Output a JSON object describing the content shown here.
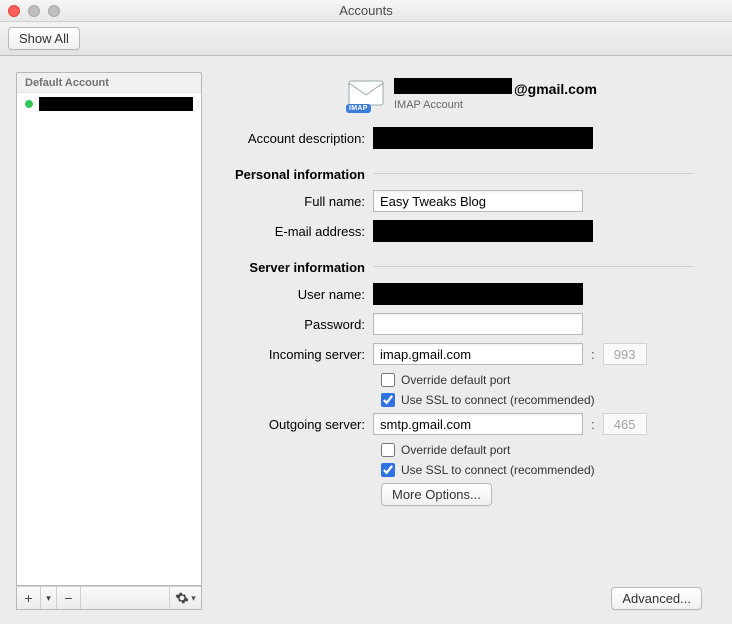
{
  "window": {
    "title": "Accounts"
  },
  "toolbar": {
    "show_all": "Show All"
  },
  "sidebar": {
    "group_label": "Default Account",
    "accounts": [
      {
        "name_redacted": true,
        "online": true
      }
    ],
    "icons": {
      "add": "+",
      "remove": "−",
      "gear": "gear"
    }
  },
  "main": {
    "header": {
      "email_suffix": "@gmail.com",
      "type_label": "IMAP Account",
      "imap_badge": "IMAP"
    },
    "labels": {
      "account_description": "Account description:",
      "personal_info": "Personal information",
      "full_name": "Full name:",
      "email": "E-mail address:",
      "server_info": "Server information",
      "user_name": "User name:",
      "password": "Password:",
      "incoming": "Incoming server:",
      "outgoing": "Outgoing server:",
      "override_port": "Override default port",
      "use_ssl": "Use SSL to connect (recommended)",
      "more_options": "More Options...",
      "advanced": "Advanced..."
    },
    "values": {
      "full_name": "Easy Tweaks Blog",
      "incoming_server": "imap.gmail.com",
      "incoming_port": "993",
      "outgoing_server": "smtp.gmail.com",
      "outgoing_port": "465",
      "incoming_override": false,
      "incoming_ssl": true,
      "outgoing_override": false,
      "outgoing_ssl": true
    }
  }
}
